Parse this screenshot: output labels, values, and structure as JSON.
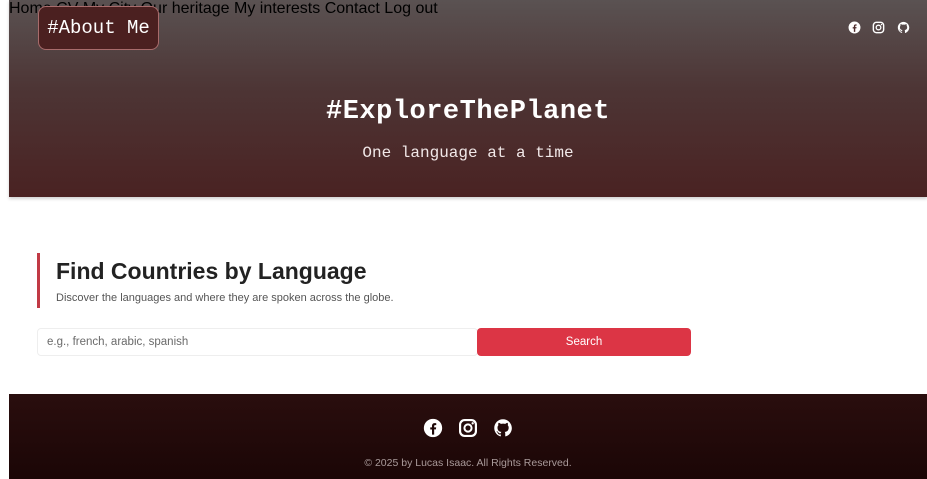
{
  "brand": {
    "label": "#About Me"
  },
  "nav": {
    "items": [
      {
        "label": "Home"
      },
      {
        "label": "CV"
      },
      {
        "label": "My City"
      },
      {
        "label": "Our heritage"
      },
      {
        "label": "My interests"
      },
      {
        "label": "Contact"
      },
      {
        "label": "Log out"
      }
    ],
    "social_icons": [
      "facebook-icon",
      "instagram-icon",
      "github-icon"
    ]
  },
  "hero": {
    "title": "#ExploreThePlanet",
    "subtitle": "One language at a time"
  },
  "search_section": {
    "title": "Find Countries by Language",
    "description": "Discover the languages and where they are spoken across the globe.",
    "input_value": "",
    "input_placeholder": "e.g., french, arabic, spanish",
    "button_label": "Search"
  },
  "footer": {
    "social_icons": [
      "facebook-icon",
      "instagram-icon",
      "github-icon"
    ],
    "copyright": "© 2025 by Lucas Isaac. All Rights Reserved."
  },
  "colors": {
    "accent": "#dc3545",
    "hero_top": "#5a5252",
    "hero_bottom": "#4a2222",
    "footer": "#1b0606"
  }
}
